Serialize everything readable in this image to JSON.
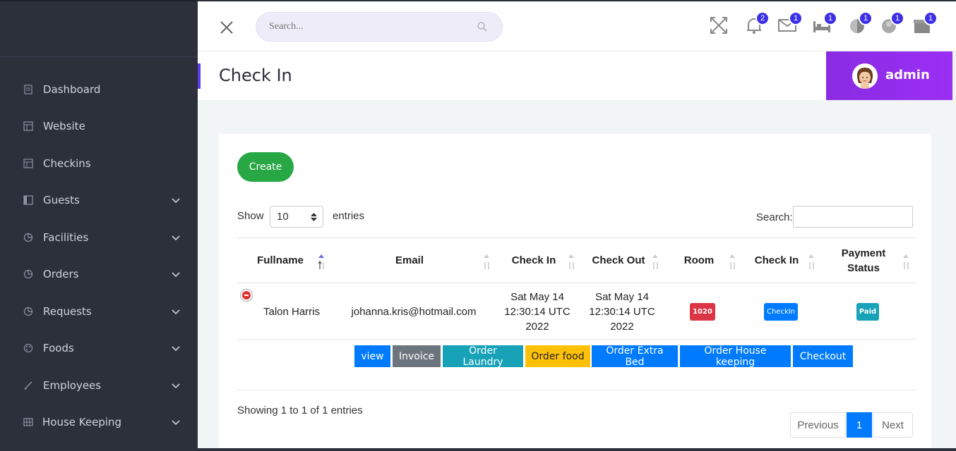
{
  "sidebar": {
    "items": [
      {
        "label": "Dashboard",
        "icon": "document-icon",
        "expandable": false
      },
      {
        "label": "Website",
        "icon": "layout-icon",
        "expandable": false
      },
      {
        "label": "Checkins",
        "icon": "layout-icon",
        "expandable": false
      },
      {
        "label": "Guests",
        "icon": "sidebar-panel-icon",
        "expandable": true
      },
      {
        "label": "Facilities",
        "icon": "pie-chart-icon",
        "expandable": true
      },
      {
        "label": "Orders",
        "icon": "pie-chart-icon",
        "expandable": true
      },
      {
        "label": "Requests",
        "icon": "pie-chart-icon",
        "expandable": true
      },
      {
        "label": "Foods",
        "icon": "palette-icon",
        "expandable": true
      },
      {
        "label": "Employees",
        "icon": "pen-icon",
        "expandable": true
      },
      {
        "label": "House Keeping",
        "icon": "grid-icon",
        "expandable": true
      }
    ]
  },
  "topbar": {
    "search_placeholder": "Search...",
    "badges": {
      "notifications": "2",
      "messages": "1",
      "rooms": "1",
      "stats": "1",
      "profile": "1",
      "inbox": "1"
    }
  },
  "page": {
    "title": "Check In",
    "user": "admin"
  },
  "controls": {
    "create_label": "Create",
    "show_label": "Show",
    "page_size": "10",
    "entries_label": "entries",
    "search_label": "Search:"
  },
  "table": {
    "headers": [
      "Fullname",
      "Email",
      "Check In",
      "Check Out",
      "Room",
      "Check In",
      "Payment Status"
    ],
    "rows": [
      {
        "fullname": "Talon Harris",
        "email": "johanna.kris@hotmail.com",
        "check_in": "Sat May 14 12:30:14 UTC 2022",
        "check_out": "Sat May 14 12:30:14 UTC 2022",
        "room": "1020",
        "status": "CheckIn",
        "payment": "Paid"
      }
    ],
    "actions": [
      "view",
      "Invoice",
      "Order Laundry",
      "Order food",
      "Order Extra Bed",
      "Order House keeping",
      "Checkout"
    ]
  },
  "footer": {
    "info": "Showing 1 to 1 of 1 entries",
    "previous": "Previous",
    "current_page": "1",
    "next": "Next"
  },
  "colors": {
    "sidebar_bg": "#2b303b",
    "accent": "#5a3cf0",
    "admin_bg": "#8a2be2",
    "create": "#28a745",
    "room_badge": "#dc3545",
    "status_badge": "#007bff",
    "paid_badge": "#17a2b8"
  }
}
